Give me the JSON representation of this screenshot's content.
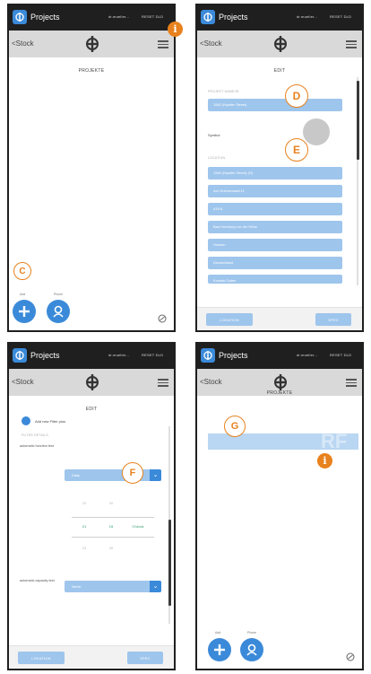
{
  "app": {
    "title": "Projects",
    "user": "dr.mueller...",
    "reset": "RESET DLD",
    "back": "<Stock"
  },
  "screen1": {
    "title": "PROJEKTE",
    "fab_add_label": "Add",
    "fab_phone_label": "Phone",
    "callout_c": "C",
    "info": "i"
  },
  "screen2": {
    "title": "EDIT",
    "section_project_name": "PROJEKT NAME/ID",
    "project_name_value": "1562 (Hyatter Street)",
    "symbol_label": "Symbol",
    "section_location": "LOCATION",
    "location_lines": [
      "1562 (Hyatter Street) (H)",
      "Am Zeichenwald 11",
      "41191",
      "Bad Homburg vor der Höhe",
      "Hessen",
      "Deutschland",
      "Kontakt Daten"
    ],
    "callout_d": "D",
    "callout_e": "E",
    "btn_left": "LOKATION",
    "btn_right": "SPEC"
  },
  "screen3": {
    "title": "EDIT",
    "add_text": "Add new Filter plus",
    "section_label": "FILTER DETAILS",
    "auto_function_label": "automatic function test",
    "auto_function_value": "Daily",
    "picker_rows": [
      [
        "20",
        "00",
        ""
      ],
      [
        "21",
        "15",
        "AM"
      ],
      [
        "18",
        "30",
        "O'clock"
      ],
      [
        "23",
        "45",
        ""
      ]
    ],
    "auto_capacity_label": "automatic capacity test",
    "auto_capacity_value": "Never",
    "callout_f": "F",
    "btn_left": "LOKATION",
    "btn_right": "SPEC"
  },
  "screen4": {
    "title": "PROJEKTE",
    "row_text": "",
    "watermark": "RF",
    "callout_g": "G",
    "info": "i",
    "fab_add_label": "Add",
    "fab_phone_label": "Phone"
  },
  "colors": {
    "accent": "#3b8ad9",
    "field": "#9ec5ec",
    "callout": "#e8821e",
    "statusbar": "#1f1f1f",
    "navbar": "#d9d9d9"
  },
  "icons": [
    "app-icon",
    "logo-icon",
    "menu-icon",
    "plus-icon",
    "phone-icon",
    "settings-icon",
    "chevron-down-icon"
  ]
}
